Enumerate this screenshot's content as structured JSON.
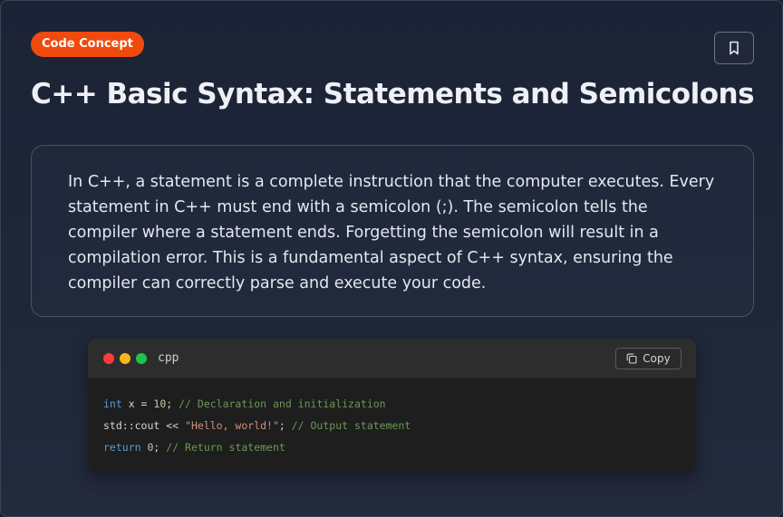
{
  "badge": {
    "label": "Code Concept"
  },
  "header": {
    "title": "C++ Basic Syntax: Statements and Semicolons",
    "bookmark_icon": "bookmark-icon"
  },
  "description": {
    "text": "In C++, a statement is a complete instruction that the computer executes. Every statement in C++ must end with a semicolon (;). The semicolon tells the compiler where a statement ends. Forgetting the semicolon will result in a compilation error. This is a fundamental aspect of C++ syntax, ensuring the compiler can correctly parse and execute your code."
  },
  "code_block": {
    "language": "cpp",
    "copy_label": "Copy",
    "copy_icon": "copy-icon",
    "lines": [
      [
        {
          "t": "int",
          "k": "kw"
        },
        {
          "t": " x = ",
          "k": "pl"
        },
        {
          "t": "10",
          "k": "num"
        },
        {
          "t": "; ",
          "k": "pl"
        },
        {
          "t": "// Declaration and initialization",
          "k": "cm"
        }
      ],
      [
        {
          "t": "std::cout << ",
          "k": "pl"
        },
        {
          "t": "\"Hello, world!\"",
          "k": "str"
        },
        {
          "t": "; ",
          "k": "pl"
        },
        {
          "t": "// Output statement",
          "k": "cm"
        }
      ],
      [
        {
          "t": "return",
          "k": "kw"
        },
        {
          "t": " ",
          "k": "pl"
        },
        {
          "t": "0",
          "k": "num"
        },
        {
          "t": "; ",
          "k": "pl"
        },
        {
          "t": "// Return statement",
          "k": "cm"
        }
      ]
    ]
  },
  "colors": {
    "badge_bg": "#f04a0e",
    "keyword": "#569cd6",
    "number": "#b5cea8",
    "string": "#ce9178",
    "comment": "#6a9955",
    "dot_red": "#ff3b3b",
    "dot_yellow": "#ffb61b",
    "dot_green": "#1fc24a"
  }
}
